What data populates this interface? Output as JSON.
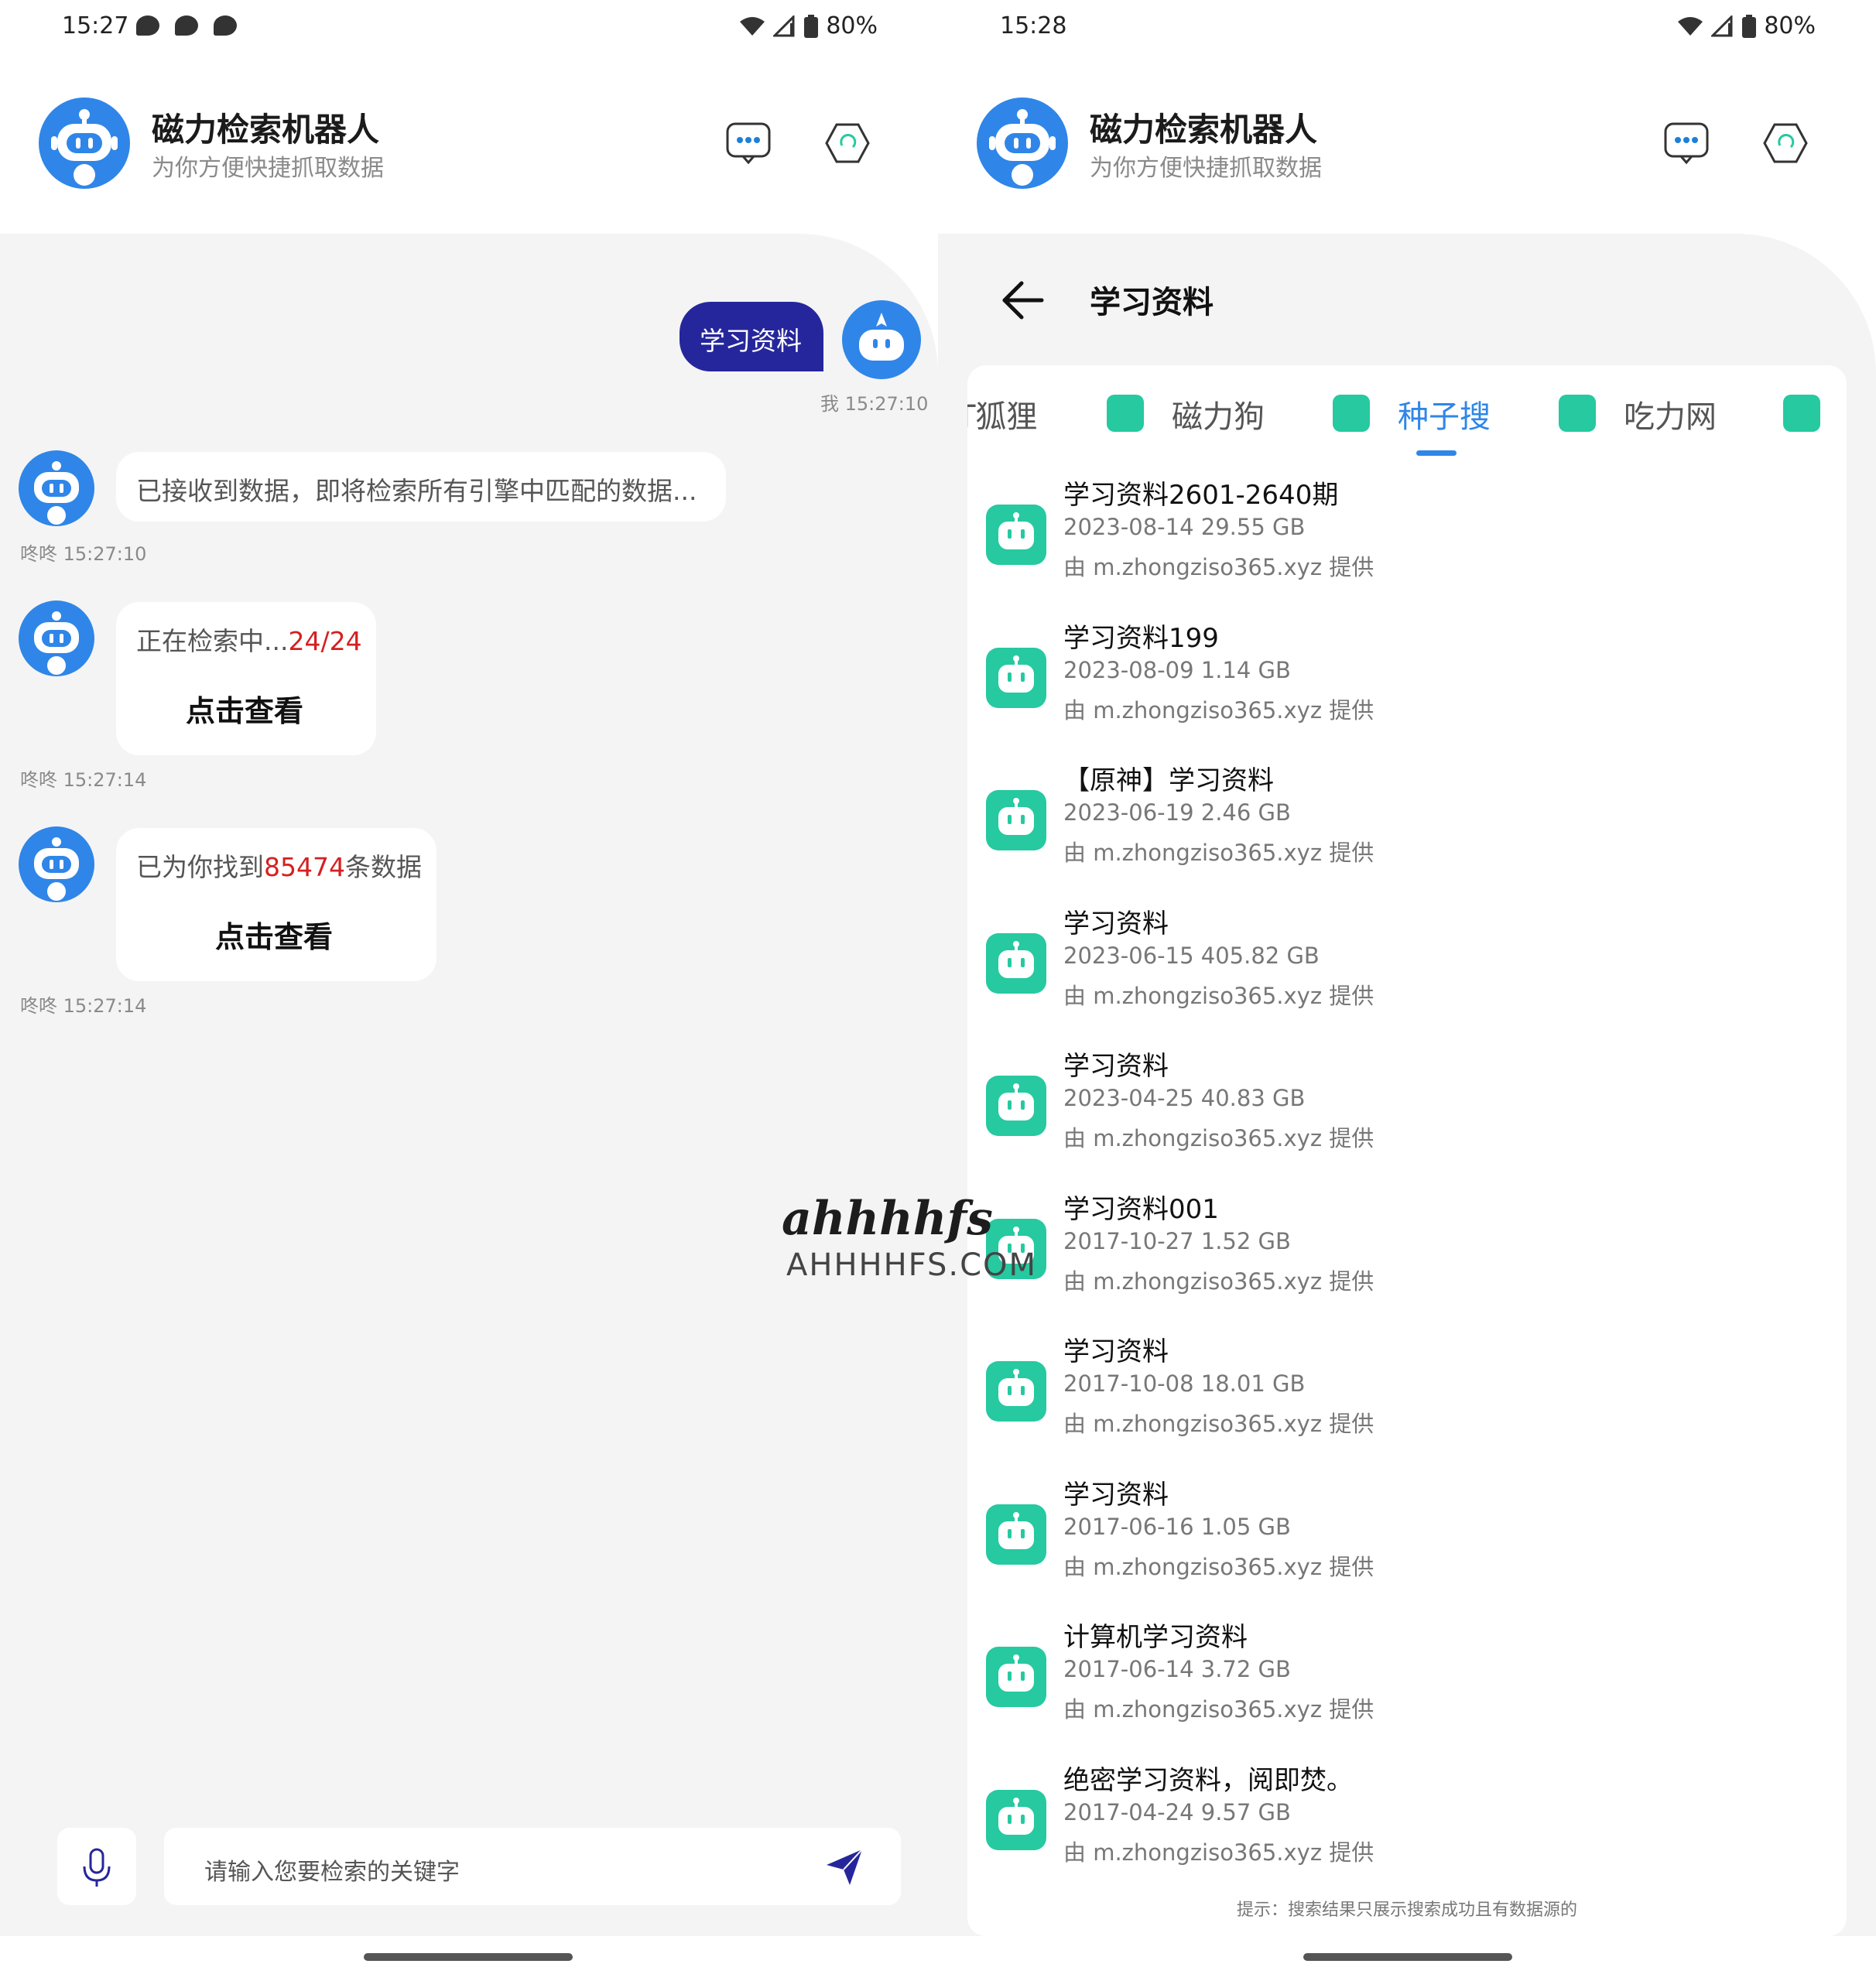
{
  "status_left": {
    "time": "15:27",
    "battery": "80%"
  },
  "status_right": {
    "time": "15:28",
    "battery": "80%"
  },
  "app": {
    "title": "磁力检索机器人",
    "subtitle": "为你方便快捷抓取数据"
  },
  "chat": {
    "user_message": {
      "text": "学习资料",
      "time": "我 15:27:10"
    },
    "bot_messages": [
      {
        "text": "已接收到数据，即将检索所有引擎中匹配的数据...",
        "time": "咚咚 15:27:10"
      },
      {
        "text_prefix": "正在检索中...",
        "text_highlight": "24/24",
        "action": "点击查看",
        "time": "咚咚 15:27:14"
      },
      {
        "text_prefix": "已为你找到",
        "text_highlight": "85474",
        "text_suffix": "条数据",
        "action": "点击查看",
        "time": "咚咚 15:27:14"
      }
    ],
    "input_placeholder": "请输入您要检索的关键字"
  },
  "results_page": {
    "title": "学习资料",
    "tabs": [
      {
        "label": "T狐狸",
        "active": false
      },
      {
        "label": "磁力狗",
        "active": false
      },
      {
        "label": "种子搜",
        "active": true
      },
      {
        "label": "吃力网",
        "active": false
      }
    ],
    "items": [
      {
        "title": "学习资料2601-2640期",
        "meta": "2023-08-14  29.55 GB",
        "source": "由 m.zhongziso365.xyz 提供"
      },
      {
        "title": "学习资料199",
        "meta": "2023-08-09  1.14 GB",
        "source": "由 m.zhongziso365.xyz 提供"
      },
      {
        "title": "【原神】学习资料",
        "meta": "2023-06-19  2.46 GB",
        "source": "由 m.zhongziso365.xyz 提供"
      },
      {
        "title": "学习资料",
        "meta": "2023-06-15  405.82 GB",
        "source": "由 m.zhongziso365.xyz 提供"
      },
      {
        "title": "学习资料",
        "meta": "2023-04-25  40.83 GB",
        "source": "由 m.zhongziso365.xyz 提供"
      },
      {
        "title": "学习资料001",
        "meta": "2017-10-27  1.52 GB",
        "source": "由 m.zhongziso365.xyz 提供"
      },
      {
        "title": "学习资料",
        "meta": "2017-10-08  18.01 GB",
        "source": "由 m.zhongziso365.xyz 提供"
      },
      {
        "title": "学习资料",
        "meta": "2017-06-16  1.05 GB",
        "source": "由 m.zhongziso365.xyz 提供"
      },
      {
        "title": "计算机学习资料",
        "meta": "2017-06-14  3.72 GB",
        "source": "由 m.zhongziso365.xyz 提供"
      },
      {
        "title": "绝密学习资料，阅即焚。",
        "meta": "2017-04-24  9.57 GB",
        "source": "由 m.zhongziso365.xyz 提供"
      }
    ],
    "hint": "提示：搜索结果只展示搜索成功且有数据源的"
  },
  "watermark": {
    "logo": "ahhhhfs",
    "domain": "AHHHHFS.COM"
  },
  "colors": {
    "primary_blue": "#2f86e8",
    "user_bubble": "#26269c",
    "accent_green": "#26c9a0",
    "highlight_red": "#d62020"
  }
}
